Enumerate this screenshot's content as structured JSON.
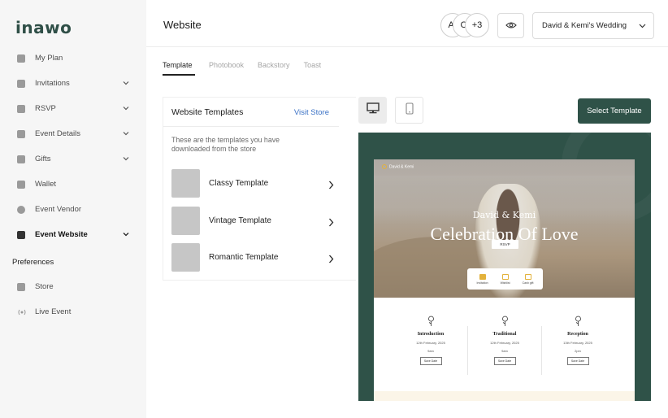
{
  "sidebar": {
    "logo": "inawo",
    "items": [
      {
        "label": "My Plan",
        "icon": "plan-icon",
        "chevron": false,
        "active": false
      },
      {
        "label": "Invitations",
        "icon": "invitation-icon",
        "chevron": true,
        "active": false
      },
      {
        "label": "RSVP",
        "icon": "rsvp-icon",
        "chevron": true,
        "active": false
      },
      {
        "label": "Event Details",
        "icon": "event-details-icon",
        "chevron": true,
        "active": false
      },
      {
        "label": "Gifts",
        "icon": "gift-icon",
        "chevron": true,
        "active": false
      },
      {
        "label": "Wallet",
        "icon": "wallet-icon",
        "chevron": false,
        "active": false
      },
      {
        "label": "Event Vendor",
        "icon": "vendor-icon",
        "chevron": false,
        "active": false
      },
      {
        "label": "Event Website",
        "icon": "website-icon",
        "chevron": true,
        "active": true
      }
    ],
    "preferences_heading": "Preferences",
    "preferences": [
      {
        "label": "Store",
        "icon": "store-icon"
      },
      {
        "label": "Live Event",
        "icon": "live-event-icon"
      }
    ]
  },
  "header": {
    "title": "Website",
    "avatars": [
      "A(",
      "CI",
      "+3"
    ],
    "event_name": "David & Kemi's Wedding"
  },
  "tabs": [
    {
      "label": "Template",
      "active": true
    },
    {
      "label": "Photobook",
      "active": false
    },
    {
      "label": "Backstory",
      "active": false
    },
    {
      "label": "Toast",
      "active": false
    }
  ],
  "templates": {
    "title": "Website Templates",
    "visit_store": "Visit Store",
    "description": "These are the templates you have downloaded from the store",
    "items": [
      {
        "name": "Classy Template"
      },
      {
        "name": "Vintage Template"
      },
      {
        "name": "Romantic Template"
      }
    ]
  },
  "select_template_label": "Select Template",
  "preview": {
    "brand": "David & Kemi",
    "names": "David & Kemi",
    "headline": "Celebration Of Love",
    "rsvp": "RSVP",
    "pill_items": [
      "Invitation",
      "Wishlist",
      "Cash gift"
    ],
    "events": [
      {
        "name": "Introduction",
        "date": "12th February, 2025",
        "time": "9am",
        "button": "Save Date"
      },
      {
        "name": "Traditional",
        "date": "12th February, 2025",
        "time": "9am",
        "button": "Save Date"
      },
      {
        "name": "Reception",
        "date": "13th February, 2025",
        "time": "2pm",
        "button": "Save Date"
      }
    ]
  },
  "colors": {
    "brand": "#2f4f47",
    "primary_button": "#2f5248",
    "link": "#3b72c6",
    "accent_gold": "#e3b23c"
  }
}
